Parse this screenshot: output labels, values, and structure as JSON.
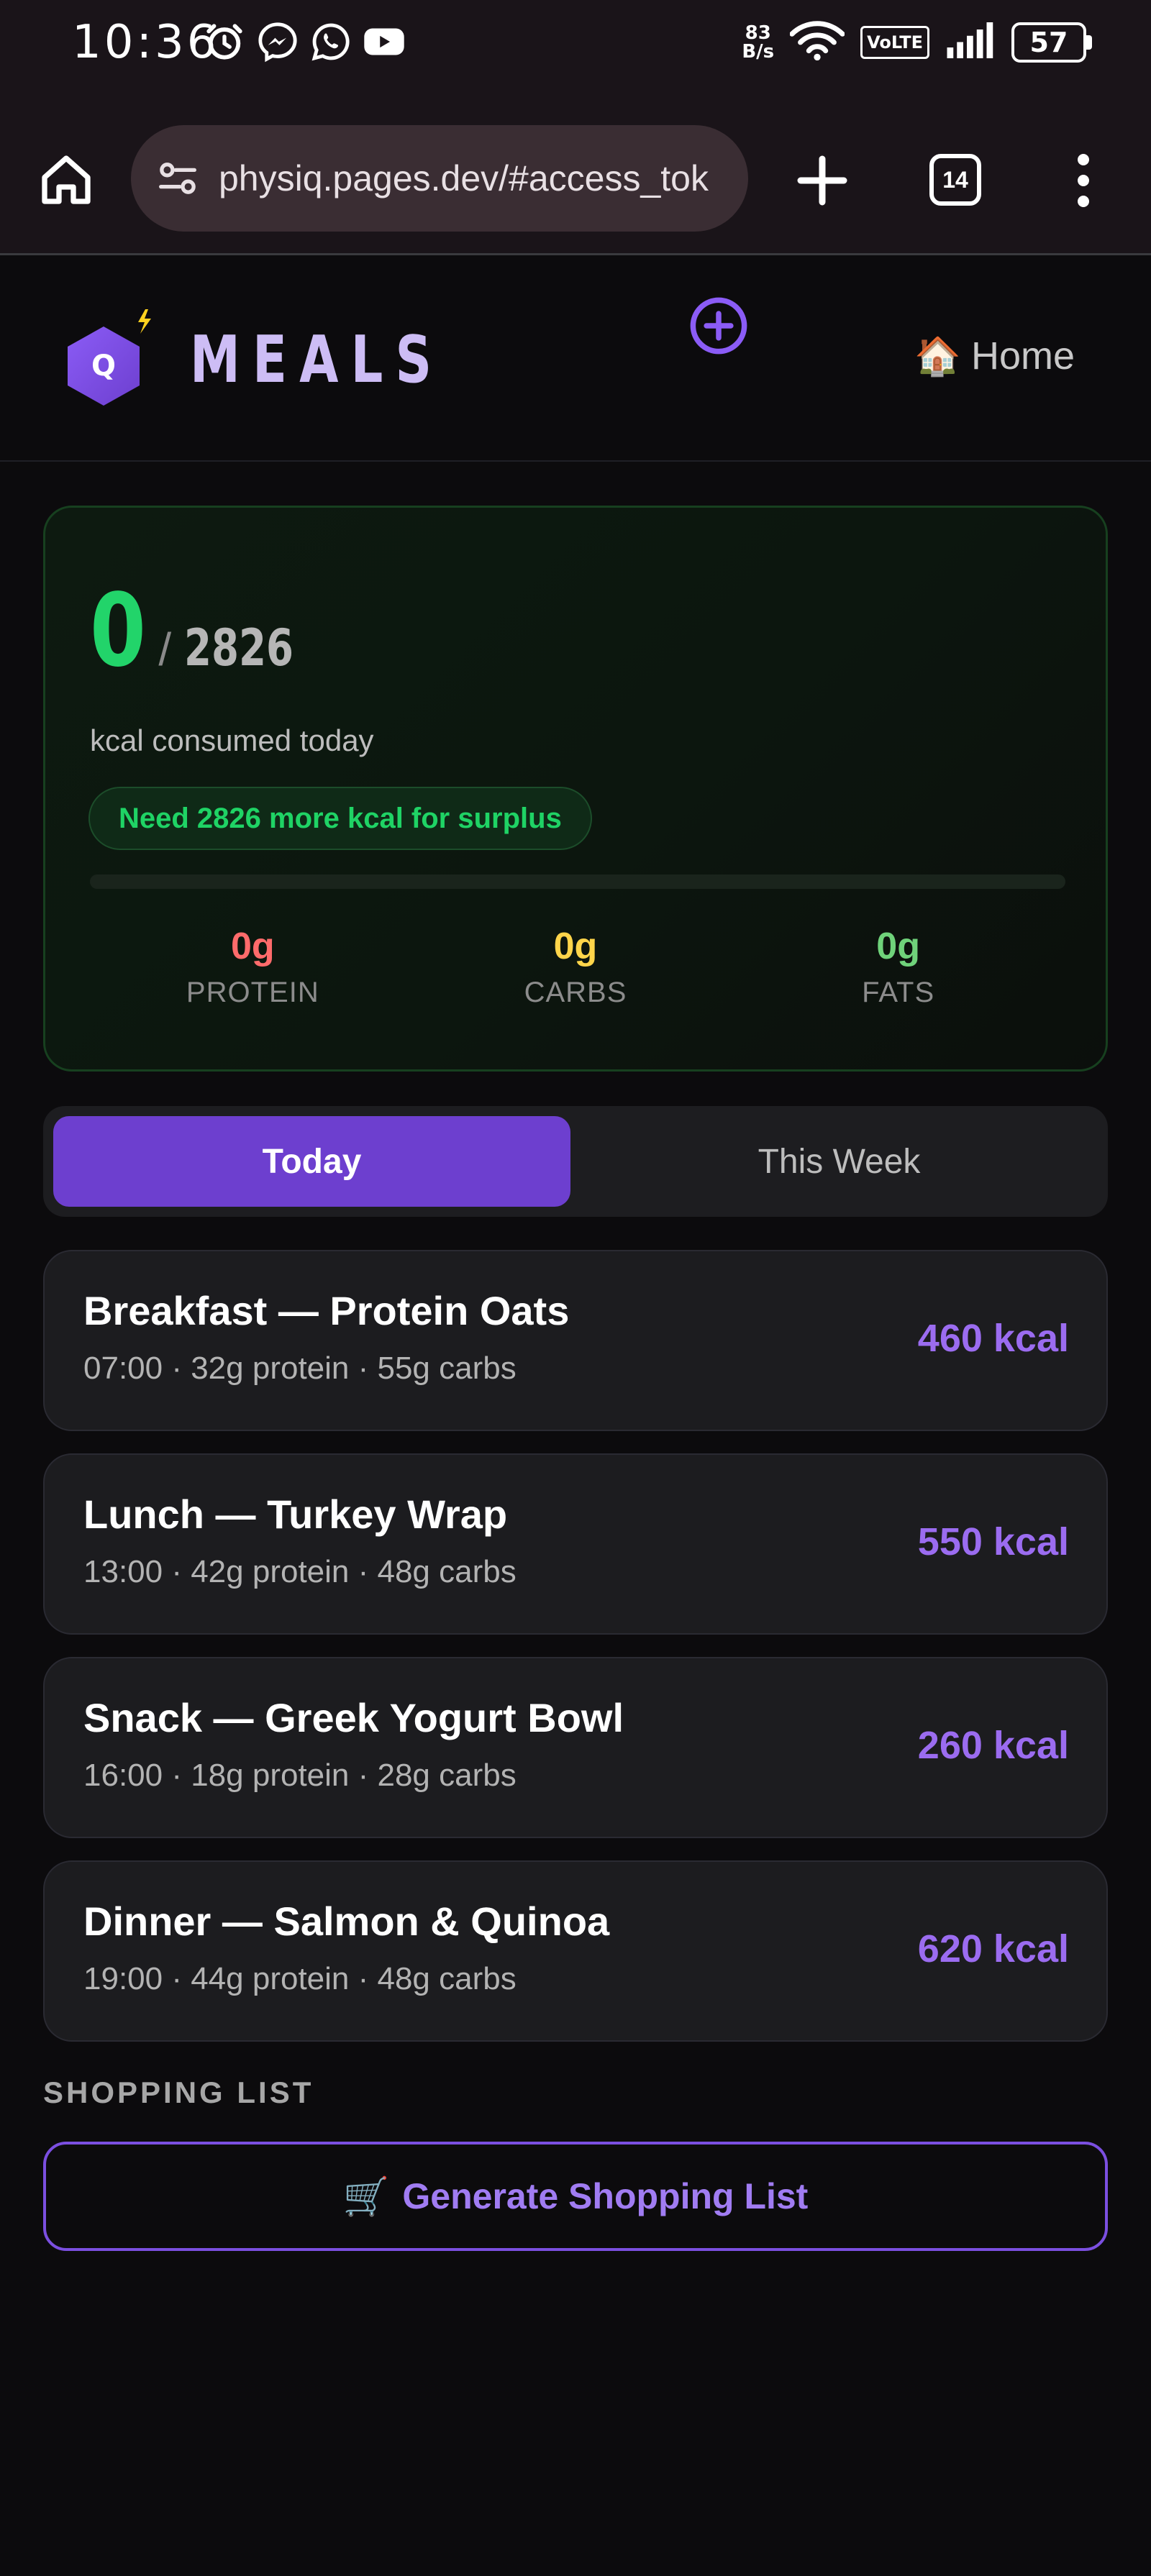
{
  "status_bar": {
    "time": "10:36",
    "net_speed_value": "83",
    "net_speed_unit": "B/s",
    "volte": "VoLTE",
    "battery": "57",
    "left_icons": [
      "alarm-icon",
      "messenger-icon",
      "whatsapp-icon",
      "youtube-icon"
    ],
    "right_icons": [
      "wifi-icon",
      "signal-icon",
      "battery-icon"
    ]
  },
  "browser": {
    "url": "physiq.pages.dev/#access_tok",
    "tab_count": "14",
    "icons": [
      "home-icon",
      "site-settings-icon",
      "new-tab-icon",
      "tabs-icon",
      "menu-icon"
    ]
  },
  "header": {
    "logo_letter": "Q",
    "brand": "MEALS",
    "home_emoji": "🏠",
    "home_label": "Home"
  },
  "summary": {
    "consumed": "0",
    "slash": "/",
    "target": "2826",
    "label": "kcal consumed today",
    "surplus_message": "Need 2826 more kcal for surplus",
    "progress_fraction": 0,
    "macros": [
      {
        "key": "protein",
        "value": "0g",
        "label": "PROTEIN",
        "color": "#ff6b6b"
      },
      {
        "key": "carbs",
        "value": "0g",
        "label": "CARBS",
        "color": "#ffd54a"
      },
      {
        "key": "fats",
        "value": "0g",
        "label": "FATS",
        "color": "#6fd27a"
      }
    ]
  },
  "tabs": [
    {
      "label": "Today",
      "active": true
    },
    {
      "label": "This Week",
      "active": false
    }
  ],
  "meals": [
    {
      "title": "Breakfast — Protein Oats",
      "meta": "07:00 · 32g protein · 55g carbs",
      "kcal": "460 kcal"
    },
    {
      "title": "Lunch — Turkey Wrap",
      "meta": "13:00 · 42g protein · 48g carbs",
      "kcal": "550 kcal"
    },
    {
      "title": "Snack — Greek Yogurt Bowl",
      "meta": "16:00 · 18g protein · 28g carbs",
      "kcal": "260 kcal"
    },
    {
      "title": "Dinner — Salmon & Quinoa",
      "meta": "19:00 · 44g protein · 48g carbs",
      "kcal": "620 kcal"
    }
  ],
  "shopping": {
    "heading": "SHOPPING LIST",
    "button_emoji": "🛒",
    "button_label": "Generate Shopping List"
  },
  "colors": {
    "accent": "#6d3fcf",
    "accent_text": "#9b6cf0",
    "kcal_green": "#22d46a",
    "background": "#0c0b0d",
    "card": "#1c1c1f"
  }
}
